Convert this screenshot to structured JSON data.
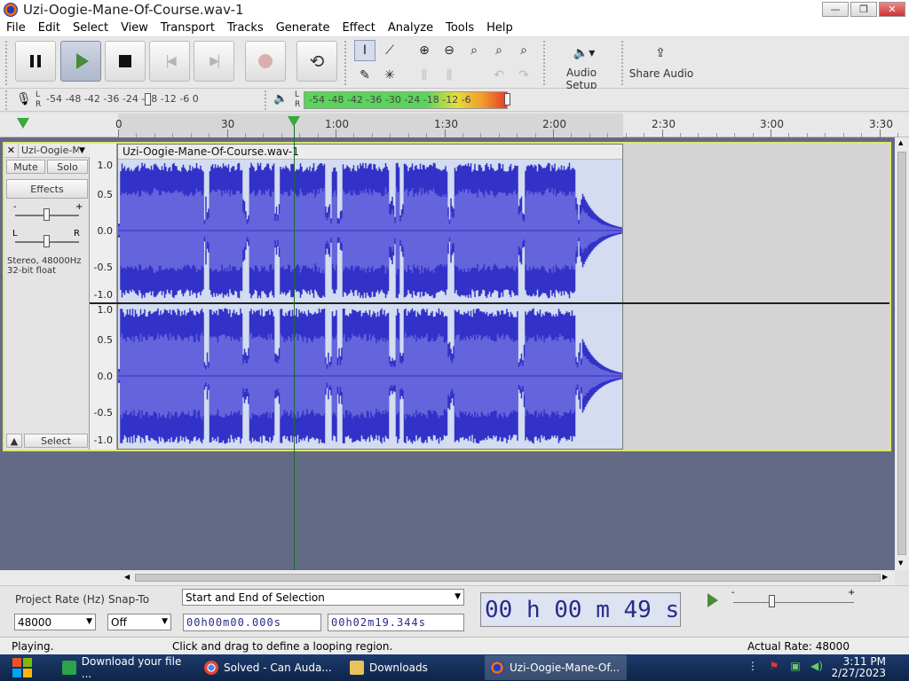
{
  "window": {
    "title": "Uzi-Oogie-Mane-Of-Course.wav-1",
    "minimize": "—",
    "restore": "❐",
    "close": "✕"
  },
  "menu": [
    "File",
    "Edit",
    "Select",
    "View",
    "Transport",
    "Tracks",
    "Generate",
    "Effect",
    "Analyze",
    "Tools",
    "Help"
  ],
  "toolbar": {
    "audio_setup_label": "Audio Setup",
    "share_audio_label": "Share Audio"
  },
  "record_meter": {
    "scale": "-54 -48 -42 -36  -24 -18 -12  -6  0",
    "l": "L",
    "r": "R"
  },
  "play_meter": {
    "scale": "-54 -48 -42 -36 -30 -24 -18 -12  -6",
    "l": "L",
    "r": "R"
  },
  "timeline": {
    "labels": [
      "0",
      "30",
      "1:00",
      "1:30",
      "2:00",
      "2:30",
      "3:00",
      "3:30"
    ]
  },
  "track": {
    "name": "Uzi-Oogie-M",
    "close": "✕",
    "mute": "Mute",
    "solo": "Solo",
    "effects": "Effects",
    "gain_minus": "-",
    "gain_plus": "+",
    "pan_l": "L",
    "pan_r": "R",
    "info_line1": "Stereo, 48000Hz",
    "info_line2": "32-bit float",
    "select": "Select",
    "collapse": "▲",
    "clip_name": "Uzi-Oogie-Mane-Of-Course.wav-1",
    "vruler": [
      "1.0",
      "0.5",
      "0.0",
      "-0.5",
      "-1.0"
    ]
  },
  "bottom": {
    "project_rate_label": "Project Rate (Hz)",
    "project_rate_value": "48000",
    "snap_to_label": "Snap-To",
    "snap_to_value": "Off",
    "selection_mode": "Start and End of Selection",
    "sel_start": "00h00m00.000s",
    "sel_end": "00h02m19.344s",
    "audio_position": "00 h 00 m 49 s",
    "speed_minus": "-",
    "speed_plus": "+"
  },
  "status": {
    "state": "Playing.",
    "hint": "Click and drag to define a looping region.",
    "rate": "Actual Rate: 48000"
  },
  "taskbar": {
    "tasks": [
      "Download your file ...",
      "Solved - Can Auda...",
      "Downloads",
      "Uzi-Oogie-Mane-Of..."
    ],
    "time": "3:11 PM",
    "date": "2/27/2023"
  }
}
